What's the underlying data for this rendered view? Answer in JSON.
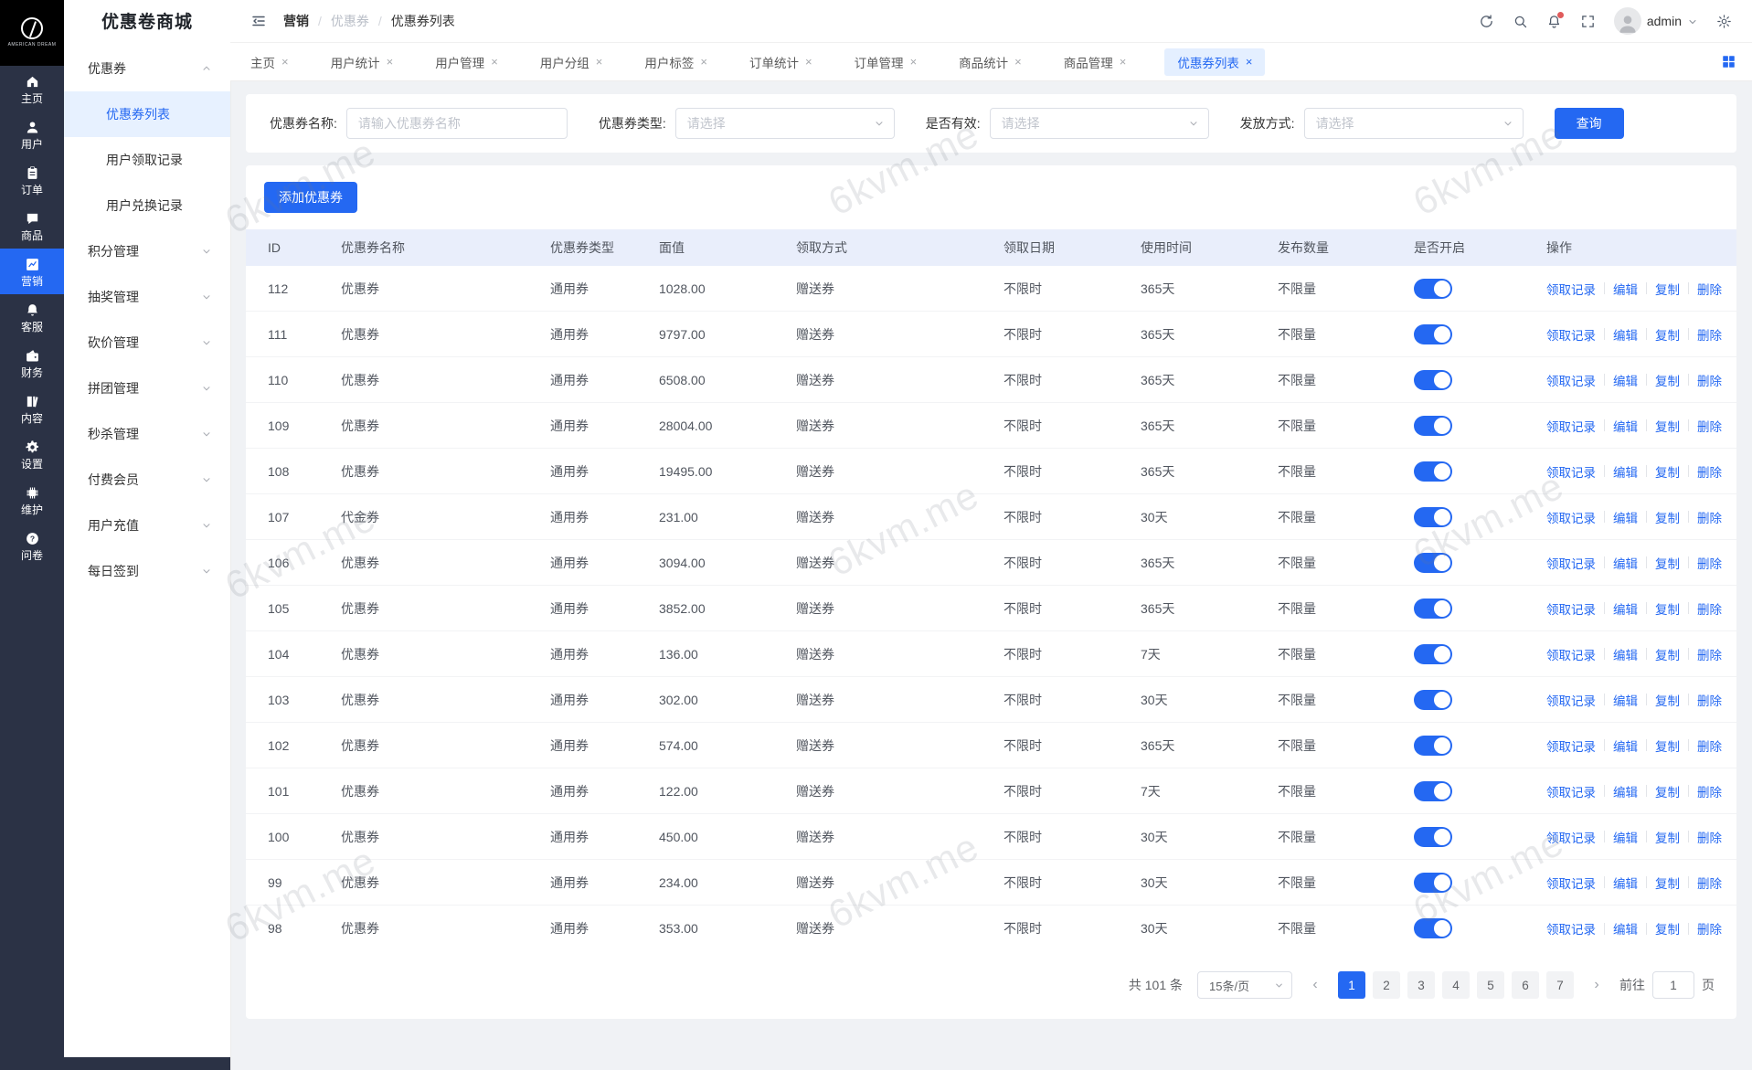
{
  "app": {
    "name": "优惠卷商城",
    "logo_text": "AMERICAN DREAM"
  },
  "rail": {
    "items": [
      {
        "label": "主页",
        "icon": "home-icon",
        "active": false
      },
      {
        "label": "用户",
        "icon": "user-icon",
        "active": false
      },
      {
        "label": "订单",
        "icon": "order-icon",
        "active": false
      },
      {
        "label": "商品",
        "icon": "goods-icon",
        "active": false
      },
      {
        "label": "营销",
        "icon": "marketing-icon",
        "active": true
      },
      {
        "label": "客服",
        "icon": "service-icon",
        "active": false
      },
      {
        "label": "财务",
        "icon": "finance-icon",
        "active": false
      },
      {
        "label": "内容",
        "icon": "content-icon",
        "active": false
      },
      {
        "label": "设置",
        "icon": "settings-icon",
        "active": false
      },
      {
        "label": "维护",
        "icon": "maintain-icon",
        "active": false
      },
      {
        "label": "问卷",
        "icon": "survey-icon",
        "active": false
      }
    ]
  },
  "sidebar": {
    "title": "优惠卷商城",
    "groups": [
      {
        "label": "优惠券",
        "expanded": true,
        "children": [
          {
            "label": "优惠券列表",
            "active": true
          },
          {
            "label": "用户领取记录",
            "active": false
          },
          {
            "label": "用户兑换记录",
            "active": false
          }
        ]
      },
      {
        "label": "积分管理",
        "expanded": false
      },
      {
        "label": "抽奖管理",
        "expanded": false
      },
      {
        "label": "砍价管理",
        "expanded": false
      },
      {
        "label": "拼团管理",
        "expanded": false
      },
      {
        "label": "秒杀管理",
        "expanded": false
      },
      {
        "label": "付费会员",
        "expanded": false
      },
      {
        "label": "用户充值",
        "expanded": false
      },
      {
        "label": "每日签到",
        "expanded": false
      }
    ]
  },
  "header": {
    "breadcrumb": [
      "营销",
      "优惠券",
      "优惠券列表"
    ],
    "user": "admin"
  },
  "tabs": {
    "items": [
      {
        "label": "主页",
        "active": false
      },
      {
        "label": "用户统计",
        "active": false
      },
      {
        "label": "用户管理",
        "active": false
      },
      {
        "label": "用户分组",
        "active": false
      },
      {
        "label": "用户标签",
        "active": false
      },
      {
        "label": "订单统计",
        "active": false
      },
      {
        "label": "订单管理",
        "active": false
      },
      {
        "label": "商品统计",
        "active": false
      },
      {
        "label": "商品管理",
        "active": false
      },
      {
        "label": "优惠券列表",
        "active": true
      }
    ]
  },
  "filters": {
    "fields": [
      {
        "label": "优惠券名称:",
        "type": "input",
        "placeholder": "请输入优惠券名称"
      },
      {
        "label": "优惠券类型:",
        "type": "select",
        "placeholder": "请选择"
      },
      {
        "label": "是否有效:",
        "type": "select",
        "placeholder": "请选择"
      },
      {
        "label": "发放方式:",
        "type": "select",
        "placeholder": "请选择"
      }
    ],
    "search_label": "查询"
  },
  "toolbar": {
    "add_label": "添加优惠券"
  },
  "table": {
    "columns": [
      "ID",
      "优惠券名称",
      "优惠券类型",
      "面值",
      "领取方式",
      "领取日期",
      "使用时间",
      "发布数量",
      "是否开启",
      "操作"
    ],
    "actions": [
      "领取记录",
      "编辑",
      "复制",
      "删除"
    ],
    "rows": [
      {
        "id": "112",
        "name": "优惠券",
        "type": "通用券",
        "value": "1028.00",
        "method": "赠送券",
        "date": "不限时",
        "duration": "365天",
        "quantity": "不限量",
        "enabled": true
      },
      {
        "id": "111",
        "name": "优惠券",
        "type": "通用券",
        "value": "9797.00",
        "method": "赠送券",
        "date": "不限时",
        "duration": "365天",
        "quantity": "不限量",
        "enabled": true
      },
      {
        "id": "110",
        "name": "优惠券",
        "type": "通用券",
        "value": "6508.00",
        "method": "赠送券",
        "date": "不限时",
        "duration": "365天",
        "quantity": "不限量",
        "enabled": true
      },
      {
        "id": "109",
        "name": "优惠券",
        "type": "通用券",
        "value": "28004.00",
        "method": "赠送券",
        "date": "不限时",
        "duration": "365天",
        "quantity": "不限量",
        "enabled": true
      },
      {
        "id": "108",
        "name": "优惠券",
        "type": "通用券",
        "value": "19495.00",
        "method": "赠送券",
        "date": "不限时",
        "duration": "365天",
        "quantity": "不限量",
        "enabled": true
      },
      {
        "id": "107",
        "name": "代金券",
        "type": "通用券",
        "value": "231.00",
        "method": "赠送券",
        "date": "不限时",
        "duration": "30天",
        "quantity": "不限量",
        "enabled": true
      },
      {
        "id": "106",
        "name": "优惠券",
        "type": "通用券",
        "value": "3094.00",
        "method": "赠送券",
        "date": "不限时",
        "duration": "365天",
        "quantity": "不限量",
        "enabled": true
      },
      {
        "id": "105",
        "name": "优惠券",
        "type": "通用券",
        "value": "3852.00",
        "method": "赠送券",
        "date": "不限时",
        "duration": "365天",
        "quantity": "不限量",
        "enabled": true
      },
      {
        "id": "104",
        "name": "优惠券",
        "type": "通用券",
        "value": "136.00",
        "method": "赠送券",
        "date": "不限时",
        "duration": "7天",
        "quantity": "不限量",
        "enabled": true
      },
      {
        "id": "103",
        "name": "优惠券",
        "type": "通用券",
        "value": "302.00",
        "method": "赠送券",
        "date": "不限时",
        "duration": "30天",
        "quantity": "不限量",
        "enabled": true
      },
      {
        "id": "102",
        "name": "优惠券",
        "type": "通用券",
        "value": "574.00",
        "method": "赠送券",
        "date": "不限时",
        "duration": "365天",
        "quantity": "不限量",
        "enabled": true
      },
      {
        "id": "101",
        "name": "优惠券",
        "type": "通用券",
        "value": "122.00",
        "method": "赠送券",
        "date": "不限时",
        "duration": "7天",
        "quantity": "不限量",
        "enabled": true
      },
      {
        "id": "100",
        "name": "优惠券",
        "type": "通用券",
        "value": "450.00",
        "method": "赠送券",
        "date": "不限时",
        "duration": "30天",
        "quantity": "不限量",
        "enabled": true
      },
      {
        "id": "99",
        "name": "优惠券",
        "type": "通用券",
        "value": "234.00",
        "method": "赠送券",
        "date": "不限时",
        "duration": "30天",
        "quantity": "不限量",
        "enabled": true
      },
      {
        "id": "98",
        "name": "优惠券",
        "type": "通用券",
        "value": "353.00",
        "method": "赠送券",
        "date": "不限时",
        "duration": "30天",
        "quantity": "不限量",
        "enabled": true
      }
    ]
  },
  "pagination": {
    "total": "共 101 条",
    "page_size": "15条/页",
    "pages": [
      "1",
      "2",
      "3",
      "4",
      "5",
      "6",
      "7"
    ],
    "active_page": "1",
    "goto_label": "前往",
    "goto_value": "1",
    "unit_label": "页"
  },
  "watermark": {
    "text": "6kvm.me"
  },
  "colors": {
    "accent": "#2468f2",
    "rail_bg": "#2b3245",
    "active_tab_bg": "#e4efff",
    "table_header_bg": "#e9eefb"
  }
}
